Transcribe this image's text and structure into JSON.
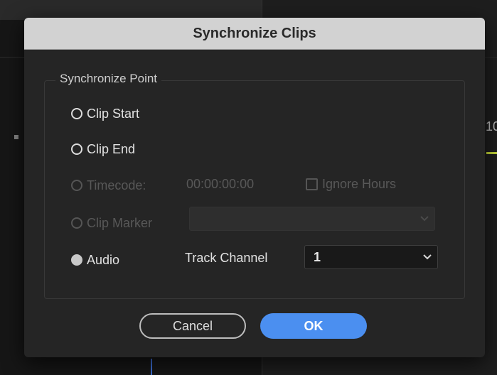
{
  "background": {
    "timeline_number": "10"
  },
  "dialog": {
    "title": "Synchronize Clips",
    "group_label": "Synchronize Point",
    "options": {
      "clip_start": "Clip Start",
      "clip_end": "Clip End",
      "timecode": "Timecode:",
      "clip_marker": "Clip Marker",
      "audio": "Audio"
    },
    "timecode_value": "00:00:00:00",
    "ignore_hours": "Ignore Hours",
    "clip_marker_select": "",
    "track_channel_label": "Track Channel",
    "track_channel_value": "1",
    "buttons": {
      "cancel": "Cancel",
      "ok": "OK"
    }
  },
  "colors": {
    "accent": "#4b8ff0",
    "titlebar": "#d2d2d2",
    "dialog_bg": "#252525"
  }
}
